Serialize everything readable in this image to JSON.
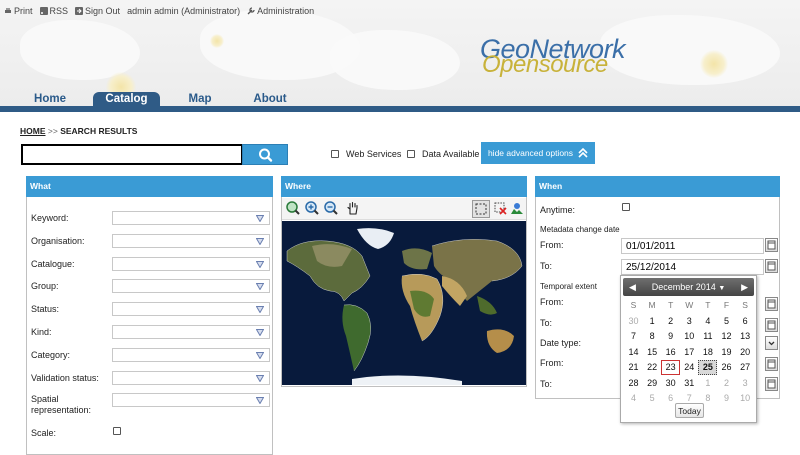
{
  "topbar": {
    "print": "Print",
    "rss": "RSS",
    "signout": "Sign Out",
    "user": "admin admin (Administrator)",
    "admin": "Administration"
  },
  "logo": {
    "line1": "GeoNetwork",
    "line2": "Opensource"
  },
  "nav": {
    "tabs": [
      "Home",
      "Catalog",
      "Map",
      "About"
    ],
    "active": "Catalog"
  },
  "breadcrumb": {
    "home": "HOME",
    "sep": ">>",
    "current": "SEARCH RESULTS"
  },
  "search": {
    "value": "",
    "web_services": "Web Services",
    "data_available": "Data Available",
    "advanced_button": "hide advanced options"
  },
  "what": {
    "title": "What",
    "fields": [
      "Keyword:",
      "Organisation:",
      "Catalogue:",
      "Group:",
      "Status:",
      "Kind:",
      "Category:",
      "Validation status:",
      "Spatial representation:"
    ],
    "scale": "Scale:"
  },
  "where": {
    "title": "Where"
  },
  "when": {
    "title": "When",
    "anytime": "Anytime:",
    "metadata_change": "Metadata change date",
    "from": "From:",
    "to": "To:",
    "from_value": "01/01/2011",
    "to_value": "25/12/2014",
    "temporal_extent": "Temporal extent",
    "from2": "From:",
    "to2": "To:",
    "date_type": "Date type:",
    "from3": "From:",
    "to3": "To:"
  },
  "calendar": {
    "month_label": "December 2014",
    "dow": [
      "S",
      "M",
      "T",
      "W",
      "T",
      "F",
      "S"
    ],
    "days": [
      [
        "30",
        "1",
        "2",
        "3",
        "4",
        "5",
        "6"
      ],
      [
        "7",
        "8",
        "9",
        "10",
        "11",
        "12",
        "13"
      ],
      [
        "14",
        "15",
        "16",
        "17",
        "18",
        "19",
        "20"
      ],
      [
        "21",
        "22",
        "23",
        "24",
        "25",
        "26",
        "27"
      ],
      [
        "28",
        "29",
        "30",
        "31",
        "1",
        "2",
        "3"
      ],
      [
        "4",
        "5",
        "6",
        "7",
        "8",
        "9",
        "10"
      ]
    ],
    "today_cell": "23",
    "selected_cell": "25",
    "today_button": "Today"
  },
  "colors": {
    "accent": "#3a9bd5",
    "nav": "#2f5b86"
  }
}
